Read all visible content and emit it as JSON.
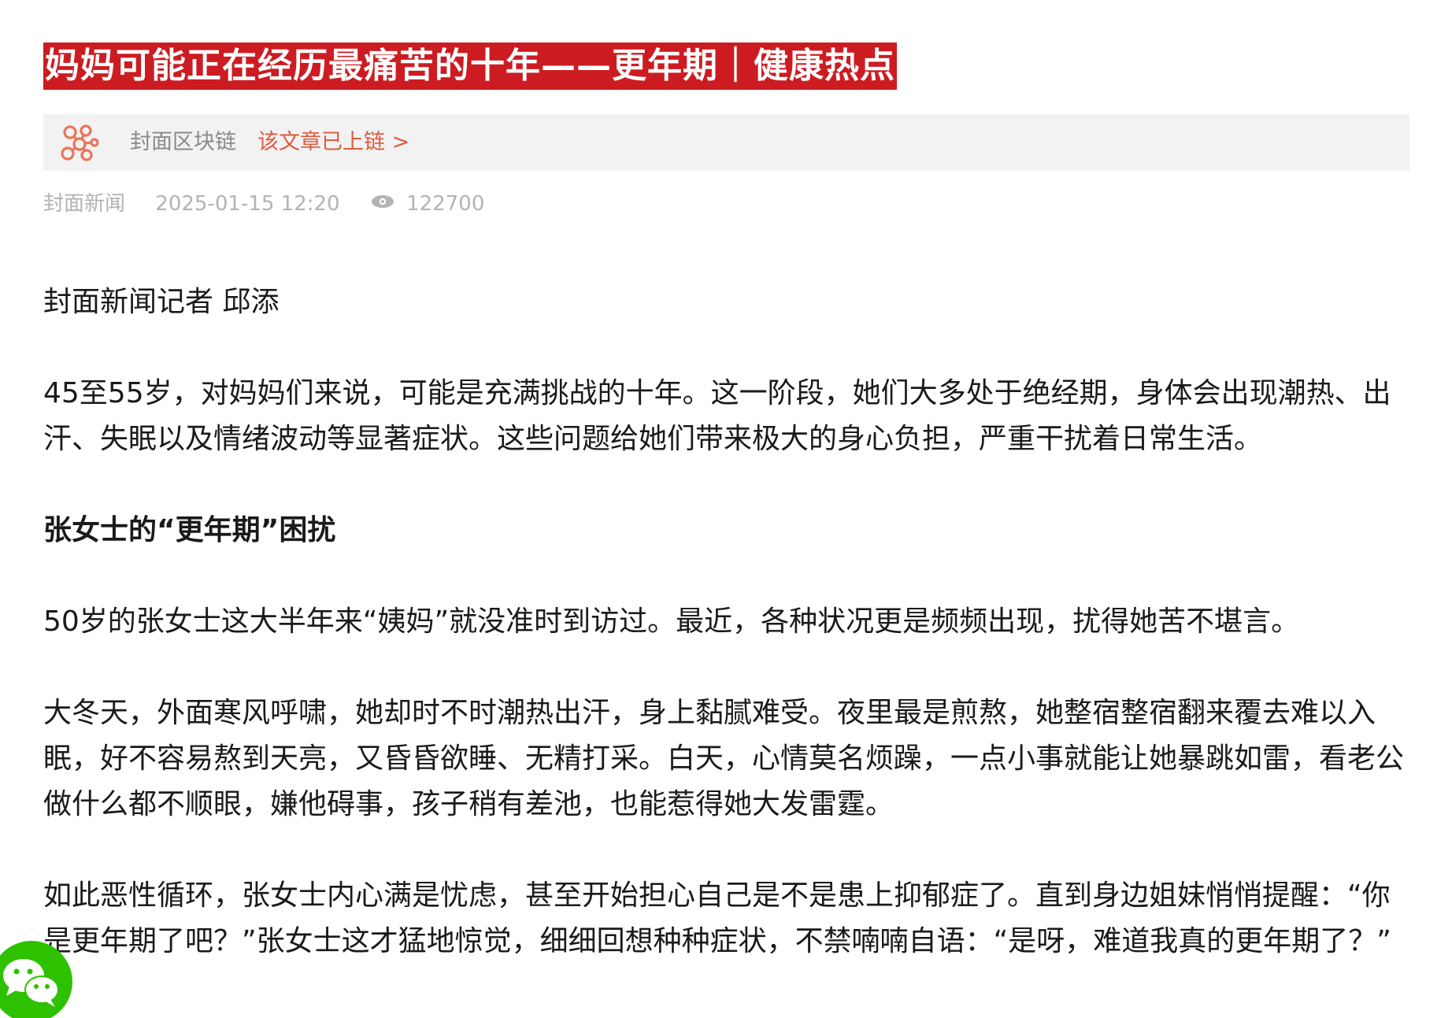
{
  "article": {
    "title": "妈妈可能正在经历最痛苦的十年——更年期｜健康热点",
    "chain": {
      "label": "封面区块链",
      "link": "该文章已上链 >"
    },
    "meta": {
      "source": "封面新闻",
      "date": "2025-01-15 12:20",
      "views": "122700"
    },
    "byline": "封面新闻记者 邱添",
    "paragraph1": "45至55岁，对妈妈们来说，可能是充满挑战的十年。这一阶段，她们大多处于绝经期，身体会出现潮热、出汗、失眠以及情绪波动等显著症状。这些问题给她们带来极大的身心负担，严重干扰着日常生活。",
    "heading1": "张女士的“更年期”困扰",
    "paragraph2": "50岁的张女士这大半年来“姨妈”就没准时到访过。最近，各种状况更是频频出现，扰得她苦不堪言。",
    "paragraph3": "大冬天，外面寒风呼啸，她却时不时潮热出汗，身上黏腻难受。夜里最是煎熬，她整宿整宿翻来覆去难以入眠，好不容易熬到天亮，又昏昏欲睡、无精打采。白天，心情莫名烦躁，一点小事就能让她暴跳如雷，看老公做什么都不顺眼，嫌他碍事，孩子稍有差池，也能惹得她大发雷霆。",
    "paragraph4": "如此恶性循环，张女士内心满是忧虑，甚至开始担心自己是不是患上抑郁症了。直到身边姐妹悄悄提醒：“你是更年期了吧？”张女士这才猛地惊觉，细细回想种种症状，不禁喃喃自语：“是呀，难道我真的更年期了？”"
  },
  "colors": {
    "title_bg": "#cc1c22",
    "chain_link": "#e05a3e",
    "wechat": "#2dc100"
  },
  "icons": {
    "chain": "blockchain-icon",
    "views": "eye-icon",
    "share": "wechat-icon"
  }
}
